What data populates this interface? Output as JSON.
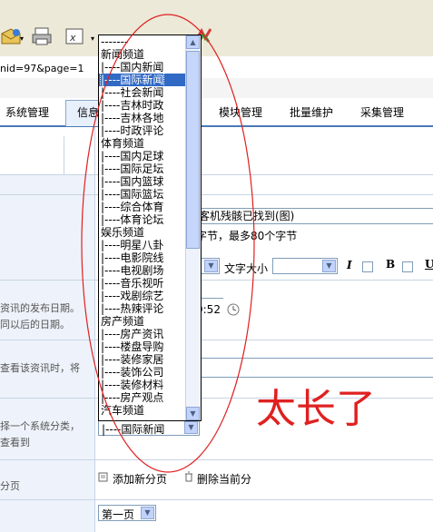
{
  "address": {
    "url_fragment": "nid=97&page=1"
  },
  "tabs": [
    {
      "label": "系统管理"
    },
    {
      "label": "信息"
    },
    {
      "label": "模块管理"
    },
    {
      "label": "批量维护"
    },
    {
      "label": "采集管理"
    }
  ],
  "form": {
    "title_value": "客机残骸已找到(图)",
    "title_hint": "字节，最多80个字节",
    "font_size_label": "文字大小",
    "bold_label": "B",
    "italic_label": "I",
    "underline_label": "U",
    "date_hint_line1": "资讯的发布日期。",
    "date_hint_line2": "同以后的日期。",
    "time_value": "9:52",
    "view_hint": "查看该资讯时，将",
    "category_hint_line1": "择一个系统分类，",
    "category_hint_line2": "查看到",
    "category_selected": "|----国际新闻",
    "paging_label": "分页",
    "add_page_label": "添加新分页",
    "delete_page_label": "删除当前分",
    "page_select_value": "第一页"
  },
  "dropdown": {
    "options": [
      "-------",
      "新闻频道",
      "|----国内新闻",
      "|----国际新闻",
      "|----社会新闻",
      "|----吉林时政",
      "|----吉林各地",
      "|----时政评论",
      "体育频道",
      "|----国内足球",
      "|----国际足坛",
      "|----国内篮球",
      "|----国际篮坛",
      "|----综合体育",
      "|----体育论坛",
      "娱乐频道",
      "|----明星八卦",
      "|----电影院线",
      "|----电视剧场",
      "|----音乐视听",
      "|----戏剧综艺",
      "|----热辣评论",
      "房产频道",
      "|----房产资讯",
      "|----楼盘导购",
      "|----装修家居",
      "|----装饰公司",
      "|----装修材料",
      "|----房产观点",
      "汽车频道"
    ],
    "selected_index": 3
  },
  "annotation": {
    "text": "太长了",
    "color": "#e02020"
  }
}
